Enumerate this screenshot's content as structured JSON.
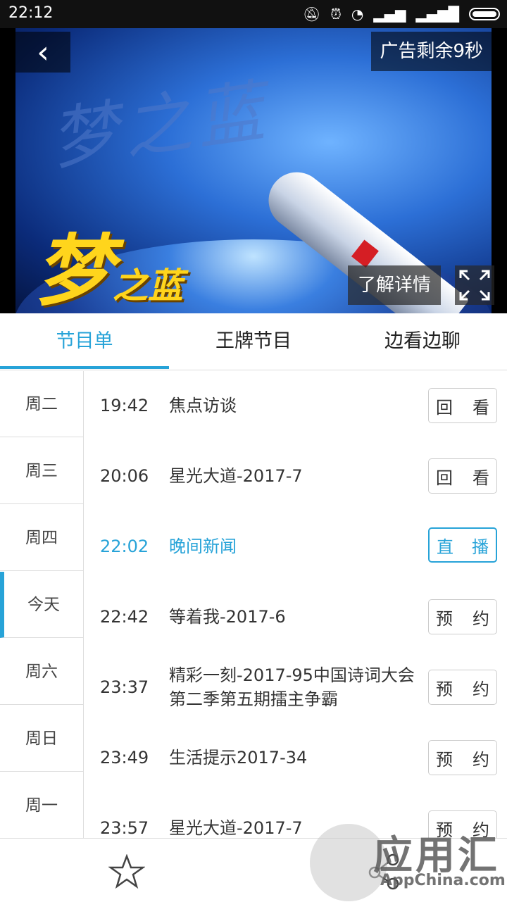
{
  "status_bar": {
    "time": "22:12"
  },
  "player": {
    "back_glyph": "‹",
    "ad_timer": "广告剩余9秒",
    "learn_more": "了解详情",
    "program_logo_big": "梦",
    "program_logo_rest": "之蓝",
    "watermark": "梦之蓝"
  },
  "tabs": [
    {
      "label": "节目单",
      "active": true
    },
    {
      "label": "王牌节目",
      "active": false
    },
    {
      "label": "边看边聊",
      "active": false
    }
  ],
  "days": [
    "周二",
    "周三",
    "周四",
    "今天",
    "周六",
    "周日",
    "周一"
  ],
  "selected_day": "今天",
  "schedule": [
    {
      "time": "19:42",
      "title": "焦点访谈",
      "action": [
        "回",
        "看"
      ],
      "state": "replay"
    },
    {
      "time": "20:06",
      "title": "星光大道-2017-7",
      "action": [
        "回",
        "看"
      ],
      "state": "replay"
    },
    {
      "time": "22:02",
      "title": "晚间新闻",
      "action": [
        "直",
        "播"
      ],
      "state": "live"
    },
    {
      "time": "22:42",
      "title": "等着我-2017-6",
      "action": [
        "预",
        "约"
      ],
      "state": "reserve"
    },
    {
      "time": "23:37",
      "title": "精彩一刻-2017-95中国诗词大会第二季第五期擂主争霸",
      "action": [
        "预",
        "约"
      ],
      "state": "reserve"
    },
    {
      "time": "23:49",
      "title": "生活提示2017-34",
      "action": [
        "预",
        "约"
      ],
      "state": "reserve"
    },
    {
      "time": "23:57",
      "title": "星光大道-2017-7",
      "action": [
        "预",
        "约"
      ],
      "state": "reserve"
    }
  ],
  "watermark_brand": {
    "cn": "应用汇",
    "en": "AppChina.com"
  },
  "colors": {
    "accent": "#27a3d8",
    "status_bar": "#111111"
  }
}
